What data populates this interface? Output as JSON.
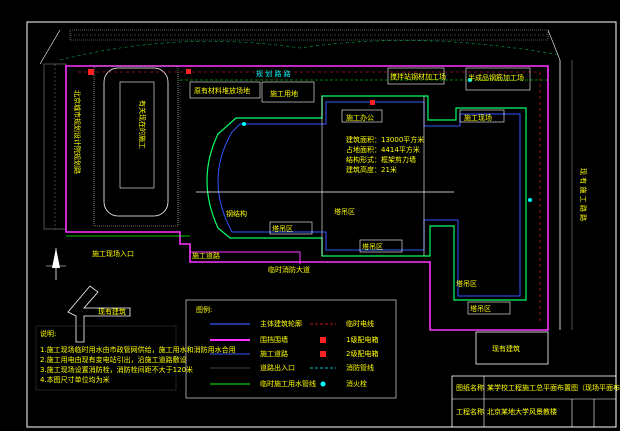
{
  "colors": {
    "frame": "#ffffff",
    "boundary": "#ff33ff",
    "building": "#00ff66",
    "road": "#3355ff",
    "fence": "#ff00ff",
    "text": "#ffff00",
    "label": "#00ffff",
    "pipe": "#00ff00",
    "hydrant": "#ff2222"
  },
  "labels": {
    "top_road": "规 划 路 路",
    "north_label_1": "原有材料堆放场地",
    "north_label_2": "施工用地",
    "north_label_3": "搅拌站钢材加工场",
    "north_label_4": "半成品钢筋加工场",
    "left_road": "北京城市规划设计院规划路",
    "left_small": "旧址",
    "inner_block": "有关现在的施工",
    "right_road": "现 有 施 工 路 路",
    "zone_1": "施工办公",
    "zone_2": "施工现场",
    "zone_3": "钢结构",
    "zone_4": "塔吊区",
    "zone_5": "塔吊区",
    "zone_6": "塔吊区",
    "zone_7": "塔吊区",
    "zone_8": "塔吊区",
    "zone_9": "塔吊区",
    "entrance": "施工现场入口",
    "construction_road": "施工道路",
    "fire_road": "临时消防大道",
    "existing_building_1": "现有建筑",
    "existing_building_2": "现有建筑",
    "notes_title": "说明:",
    "note_1": "1.施工现场临时用水由市政管网供给，施工用水和消防用水合用",
    "note_2": "2.施工用电由现有变电站引出，沿施工道路敷设",
    "note_3": "3.施工现场设置消防栓，消防栓间距不大于120米",
    "note_4": "4.本图尺寸单位均为米",
    "info_1": "建筑面积：13000平方米",
    "info_2": "占地面积：4414平方米",
    "info_3": "结构形式：框架剪力墙",
    "info_4": "建筑高度：21米"
  },
  "legend": {
    "title": "图例:",
    "items": [
      {
        "label": "主体建筑轮廓",
        "style": "road"
      },
      {
        "label": "围挡围墙",
        "style": "fence"
      },
      {
        "label": "施工道路",
        "style": "construction"
      },
      {
        "label": "道路出入口",
        "style": "entrance"
      },
      {
        "label": "临时施工用水管线",
        "style": "pipe"
      }
    ],
    "items_right": [
      {
        "label": "临时电线",
        "style": "dash-red"
      },
      {
        "label": "1级配电箱",
        "style": "box-red"
      },
      {
        "label": "2级配电箱",
        "style": "box-red"
      },
      {
        "label": "消防管线",
        "style": "dash-cyan"
      },
      {
        "label": "消火栓",
        "style": "dot-cyan"
      }
    ]
  },
  "title_block": {
    "row1_label": "图纸名称",
    "row1_value": "某学校工程施工总平面布置图（现场平面布置图）",
    "row2_label": "工程名称",
    "row2_value": "北京某地大学风景教楼"
  }
}
